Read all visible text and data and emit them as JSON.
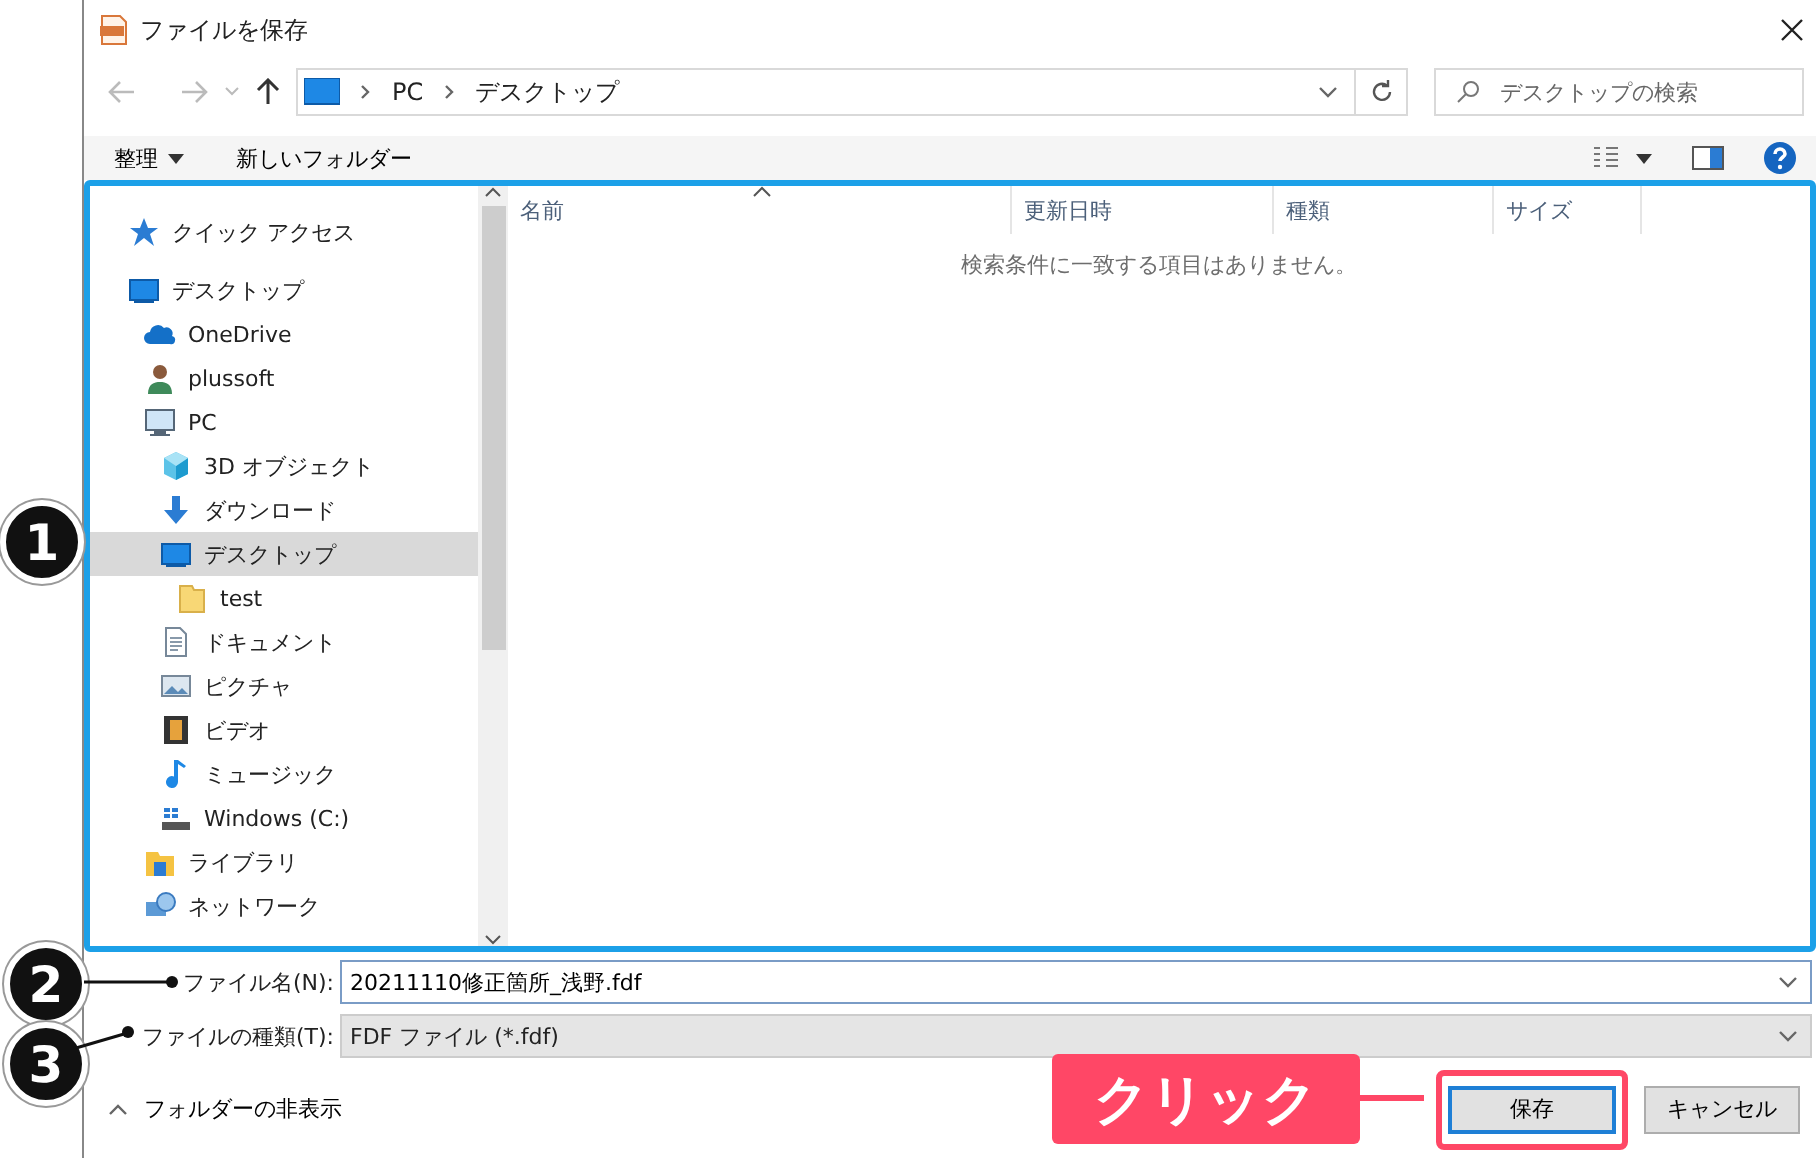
{
  "window": {
    "title": "ファイルを保存"
  },
  "address_bar": {
    "path": [
      "PC",
      "デスクトップ"
    ]
  },
  "search": {
    "placeholder": "デスクトップの検索"
  },
  "toolbar": {
    "organize": "整理",
    "new_folder": "新しいフォルダー"
  },
  "navigation_pane": {
    "items": [
      {
        "label": "クイック アクセス",
        "kind": "star",
        "selected": false
      },
      {
        "label": "デスクトップ",
        "kind": "desktop",
        "selected": false,
        "children": [
          {
            "label": "OneDrive",
            "kind": "cloud",
            "selected": false
          },
          {
            "label": "plussoft",
            "kind": "user",
            "selected": false
          },
          {
            "label": "PC",
            "kind": "computer",
            "selected": false,
            "children": [
              {
                "label": "3D オブジェクト",
                "kind": "cube",
                "selected": false
              },
              {
                "label": "ダウンロード",
                "kind": "download",
                "selected": false
              },
              {
                "label": "デスクトップ",
                "kind": "desktop",
                "selected": true,
                "children": [
                  {
                    "label": "test",
                    "kind": "folder",
                    "selected": false
                  }
                ]
              },
              {
                "label": "ドキュメント",
                "kind": "document",
                "selected": false
              },
              {
                "label": "ピクチャ",
                "kind": "picture",
                "selected": false
              },
              {
                "label": "ビデオ",
                "kind": "video",
                "selected": false
              },
              {
                "label": "ミュージック",
                "kind": "music",
                "selected": false
              },
              {
                "label": "Windows (C:)",
                "kind": "drive",
                "selected": false
              }
            ]
          },
          {
            "label": "ライブラリ",
            "kind": "library",
            "selected": false
          },
          {
            "label": "ネットワーク",
            "kind": "network",
            "selected": false
          }
        ]
      }
    ]
  },
  "file_list": {
    "columns": [
      {
        "label": "名前",
        "sorted": true
      },
      {
        "label": "更新日時",
        "sorted": false
      },
      {
        "label": "種類",
        "sorted": false
      },
      {
        "label": "サイズ",
        "sorted": false
      }
    ],
    "empty_message": "検索条件に一致する項目はありません。"
  },
  "file_name": {
    "label": "ファイル名(N):",
    "value": "20211110修正箇所_浅野.fdf"
  },
  "file_type": {
    "label": "ファイルの種類(T):",
    "value": "FDF ファイル (*.fdf)"
  },
  "hide_folders": "フォルダーの非表示",
  "buttons": [
    {
      "label": "保存",
      "default": true
    },
    {
      "label": "キャンセル",
      "default": false
    }
  ],
  "annotations": {
    "markers": [
      "1",
      "2",
      "3"
    ],
    "callout": "クリック"
  }
}
